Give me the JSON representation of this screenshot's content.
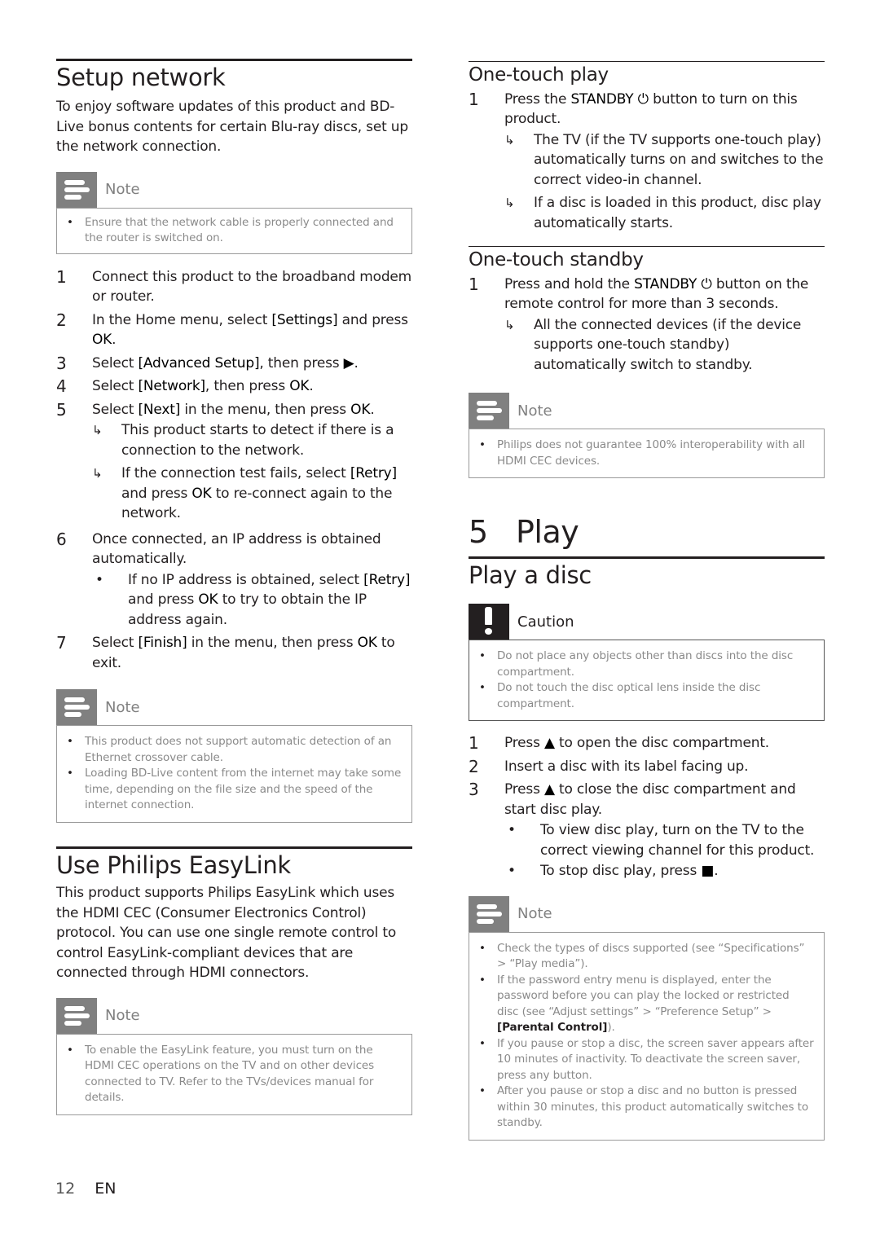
{
  "left": {
    "setup_network": {
      "title": "Setup network",
      "intro": "To enjoy software updates of this product and BD-Live bonus contents for certain Blu-ray discs, set up the network connection.",
      "note": {
        "label": "Note",
        "icon": "note-icon",
        "items": [
          "Ensure that the network cable is properly connected and the router is switched on."
        ]
      },
      "steps": [
        {
          "n": "1",
          "text": "Connect this product to the broadband modem or router."
        },
        {
          "n": "2",
          "pre": "In the Home menu, select ",
          "key": "[Settings]",
          "mid": " and press ",
          "key2": "OK",
          "post": "."
        },
        {
          "n": "3",
          "pre": "Select ",
          "key": "[Advanced Setup]",
          "mid": ", then press ",
          "key2": "▶",
          "post": "."
        },
        {
          "n": "4",
          "pre": "Select ",
          "key": "[Network]",
          "mid": ", then press ",
          "key2": "OK",
          "post": "."
        },
        {
          "n": "5",
          "pre": "Select ",
          "key": "[Next]",
          "mid": " in the menu, then press ",
          "key2": "OK",
          "post": ".",
          "results": [
            {
              "text": "This product starts to detect if there is a connection to the network."
            },
            {
              "pre": "If the connection test fails, select ",
              "key": "[Retry]",
              "mid": " and press ",
              "key2": "OK",
              "post": " to re-connect again to the network."
            }
          ]
        },
        {
          "n": "6",
          "text": "Once connected, an IP address is obtained automatically.",
          "bullets": [
            {
              "pre": "If no IP address is obtained, select ",
              "key": "[Retry]",
              "mid": " and press ",
              "key2": "OK",
              "post": " to try to obtain the IP address again."
            }
          ]
        },
        {
          "n": "7",
          "pre": "Select ",
          "key": "[Finish]",
          "mid": " in the menu, then press ",
          "key2": "OK",
          "post": " to exit."
        }
      ],
      "note2": {
        "label": "Note",
        "items": [
          "This product does not support automatic detection of an Ethernet crossover cable.",
          "Loading BD-Live content from the internet may take some time, depending on the file size and the speed of the internet connection."
        ]
      }
    },
    "easylink": {
      "title": "Use Philips EasyLink",
      "intro": "This product supports Philips EasyLink which uses the HDMI CEC (Consumer Electronics Control) protocol. You can use one single remote control to control EasyLink-compliant devices that are connected through HDMI connectors.",
      "note": {
        "label": "Note",
        "items": [
          "To enable the EasyLink feature, you must turn on the HDMI CEC operations on the TV and on other devices connected to TV. Refer to the TVs/devices manual for details."
        ]
      }
    }
  },
  "right": {
    "one_touch_play": {
      "title": "One-touch play",
      "step": {
        "n": "1",
        "pre": "Press the ",
        "key": "STANDBY ⏻",
        "post": " button to turn on this product."
      },
      "results": [
        "The TV (if the TV supports one-touch play) automatically turns on and switches to the correct video-in channel.",
        "If a disc is loaded in this product, disc play automatically starts."
      ]
    },
    "one_touch_standby": {
      "title": "One-touch standby",
      "step": {
        "n": "1",
        "pre": "Press and hold the ",
        "key": "STANDBY ⏻",
        "post": " button on the remote control for more than 3 seconds."
      },
      "results": [
        "All the connected devices (if the device supports one-touch standby) automatically switch to standby."
      ],
      "note": {
        "label": "Note",
        "items": [
          "Philips does not guarantee 100% interoperability with all HDMI CEC devices."
        ]
      }
    },
    "chapter": {
      "number": "5",
      "title": "Play"
    },
    "play_disc": {
      "title": "Play a disc",
      "caution": {
        "label": "Caution",
        "icon": "exclamation-icon",
        "items": [
          "Do not place any objects other than discs into the disc compartment.",
          "Do not touch the disc optical lens inside the disc compartment."
        ]
      },
      "steps": [
        {
          "n": "1",
          "pre": "Press ",
          "key": "▲",
          "post": " to open the disc compartment."
        },
        {
          "n": "2",
          "text": "Insert a disc with its label facing up."
        },
        {
          "n": "3",
          "pre": "Press ",
          "key": "▲",
          "post": " to close the disc compartment and start disc play.",
          "bullets": [
            {
              "text": "To view disc play, turn on the TV to the correct viewing channel for this product."
            },
            {
              "pre": "To stop disc play, press ",
              "key": "■",
              "post": "."
            }
          ]
        }
      ],
      "note": {
        "label": "Note",
        "items": [
          {
            "text": "Check the types of discs supported (see “Specifications” > “Play media”)."
          },
          {
            "text": "If the password entry menu is displayed, enter the password before you can play the locked or restricted disc (see “Adjust settings” > “Preference Setup” > ",
            "strong": "[Parental Control]",
            "post": ")."
          },
          {
            "text": "If you pause or stop a disc, the screen saver appears after 10 minutes of inactivity. To deactivate the screen saver, press any button."
          },
          {
            "text": "After you pause or stop a disc and no button is pressed within 30 minutes, this product automatically switches to standby."
          }
        ]
      }
    }
  },
  "footer": {
    "page": "12",
    "lang": "EN"
  }
}
